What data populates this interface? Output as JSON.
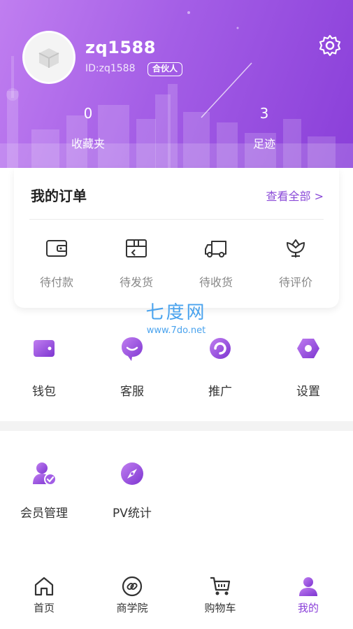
{
  "profile": {
    "username": "zq1588",
    "user_id": "ID:zq1588",
    "badge": "合伙人",
    "stats": [
      {
        "value": "0",
        "label": "收藏夹"
      },
      {
        "value": "3",
        "label": "足迹"
      }
    ]
  },
  "orders": {
    "title": "我的订单",
    "view_all": "查看全部 >",
    "items": [
      {
        "label": "待付款",
        "icon": "wallet-icon"
      },
      {
        "label": "待发货",
        "icon": "box-icon"
      },
      {
        "label": "待收货",
        "icon": "truck-icon"
      },
      {
        "label": "待评价",
        "icon": "flower-icon"
      }
    ]
  },
  "watermark": {
    "name": "七度网",
    "url": "www.7do.net"
  },
  "tools": [
    {
      "label": "钱包",
      "icon": "wallet-icon"
    },
    {
      "label": "客服",
      "icon": "chat-icon"
    },
    {
      "label": "推广",
      "icon": "share-icon"
    },
    {
      "label": "设置",
      "icon": "settings-icon"
    }
  ],
  "services": [
    {
      "label": "会员管理",
      "icon": "member-icon"
    },
    {
      "label": "PV统计",
      "icon": "compass-icon"
    }
  ],
  "tabbar": [
    {
      "label": "首页",
      "icon": "home-icon"
    },
    {
      "label": "商学院",
      "icon": "link-icon"
    },
    {
      "label": "购物车",
      "icon": "cart-icon"
    },
    {
      "label": "我的",
      "icon": "user-icon",
      "active": true
    }
  ],
  "colors": {
    "accent": "#8a3fd9",
    "header_start": "#c07ef0",
    "header_end": "#8a3fd9",
    "link": "#8b4bd8",
    "watermark": "#4aa3ee"
  }
}
